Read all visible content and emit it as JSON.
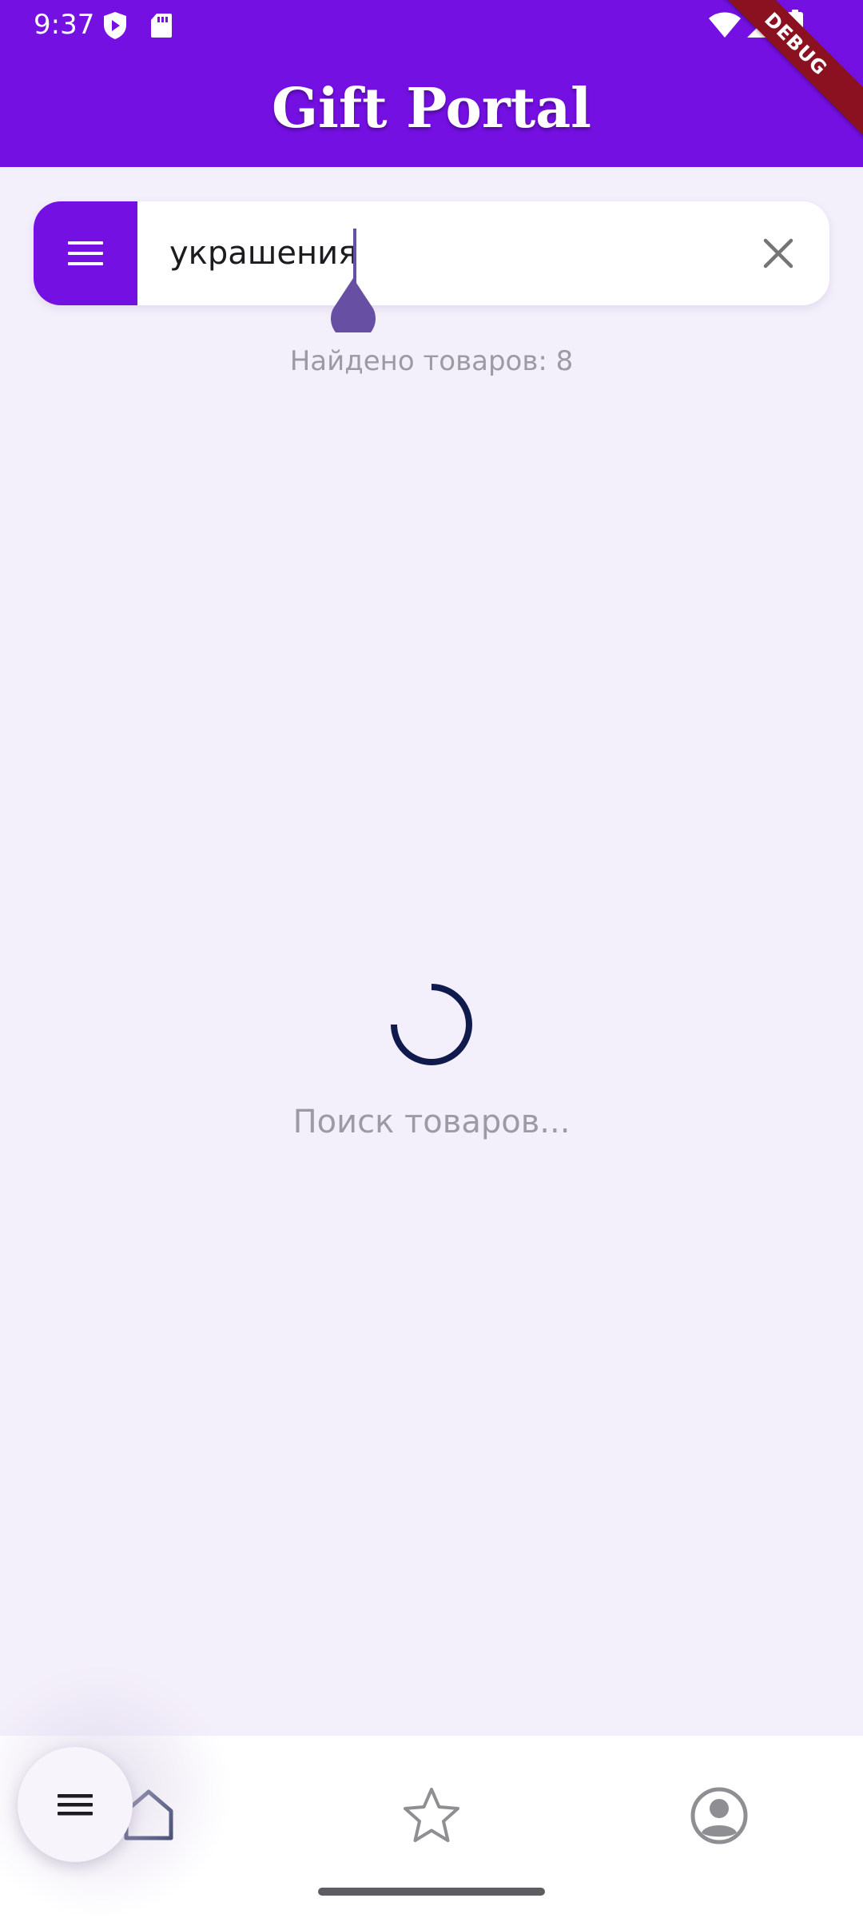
{
  "status_bar": {
    "time": "9:37",
    "icons": [
      "shield-play-icon",
      "sd-card-icon",
      "wifi-icon",
      "cell-signal-icon",
      "battery-icon"
    ]
  },
  "app_bar": {
    "title": "Gift Portal",
    "debug_banner": "DEBUG"
  },
  "search": {
    "value": "украшения",
    "menu_icon": "menu-icon",
    "clear_icon": "close-icon"
  },
  "results": {
    "count_text": "Найдено товаров: 8"
  },
  "loading": {
    "text": "Поиск товаров..."
  },
  "bottom_nav": {
    "items": [
      {
        "icon": "home-icon"
      },
      {
        "icon": "star-icon"
      },
      {
        "icon": "account-circle-icon"
      }
    ]
  },
  "fab": {
    "icon": "menu-icon"
  },
  "colors": {
    "primary": "#7510e3",
    "background": "#f4f0fb",
    "caret": "#6750a4",
    "spinner": "#0f1a4d",
    "muted_text": "#9e9aa3",
    "debug_banner": "#8c1120"
  }
}
